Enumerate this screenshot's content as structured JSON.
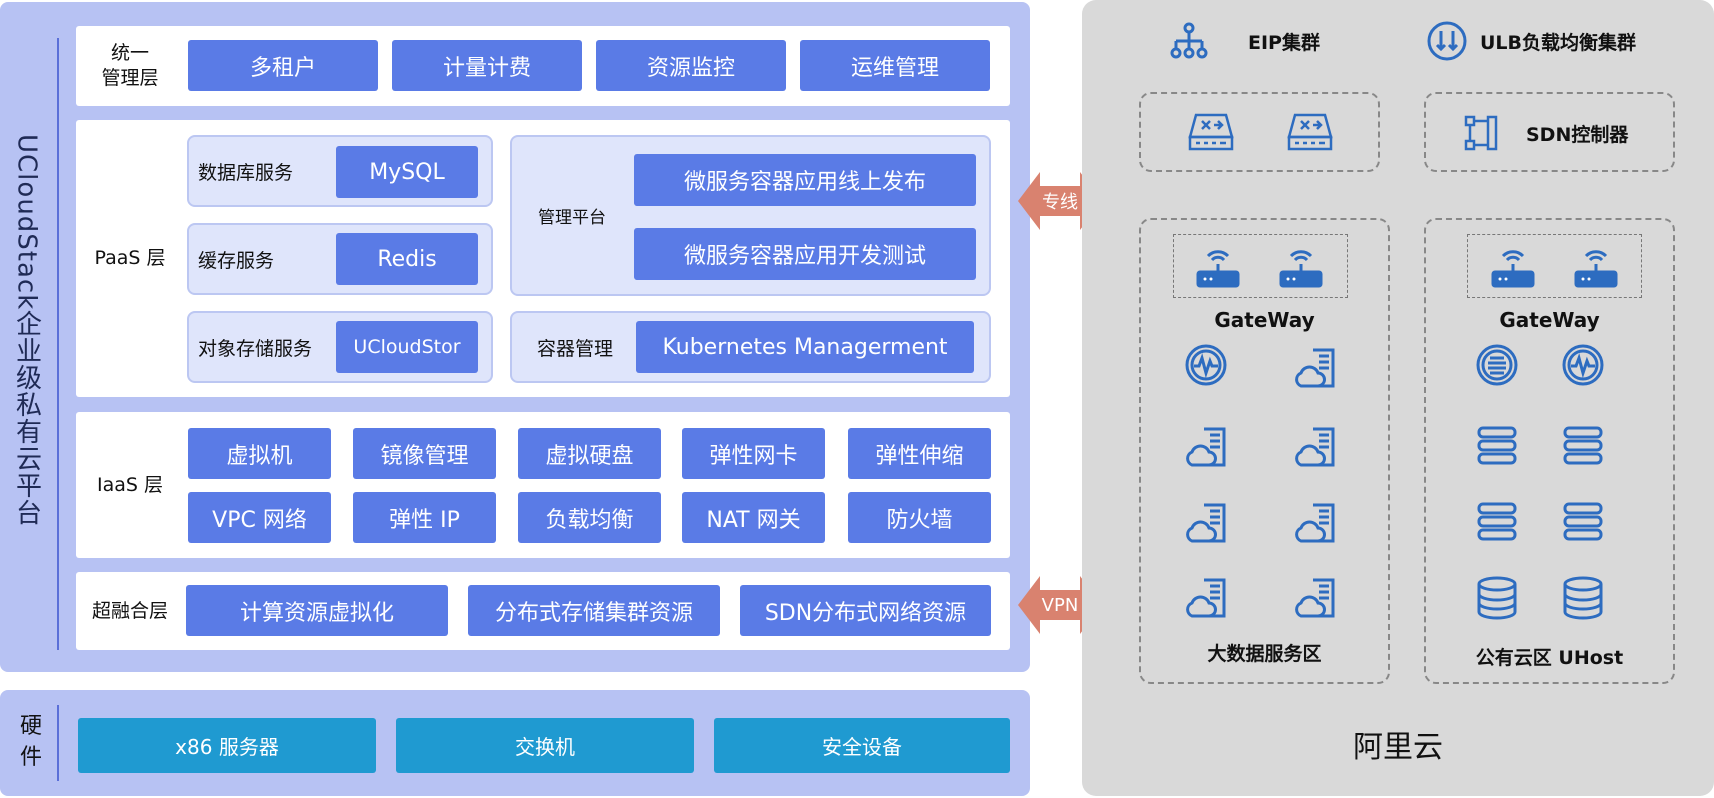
{
  "platform_title": "UCloudStack企业级私有云平台",
  "mgmt_layer": {
    "label": "统一\n管理层",
    "items": [
      "多租户",
      "计量计费",
      "资源监控",
      "运维管理"
    ]
  },
  "paas_layer": {
    "label": "PaaS 层",
    "db": {
      "label": "数据库服务",
      "value": "MySQL"
    },
    "cache": {
      "label": "缓存服务",
      "value": "Redis"
    },
    "storage": {
      "label": "对象存储服务",
      "value": "UCloudStor"
    },
    "mgmt_platform": {
      "label": "管理平台",
      "items": [
        "微服务容器应用线上发布",
        "微服务容器应用开发测试"
      ]
    },
    "container": {
      "label": "容器管理",
      "value": "Kubernetes Managerment"
    }
  },
  "iaas_layer": {
    "label": "IaaS 层",
    "row1": [
      "虚拟机",
      "镜像管理",
      "虚拟硬盘",
      "弹性网卡",
      "弹性伸缩"
    ],
    "row2": [
      "VPC 网络",
      "弹性 IP",
      "负载均衡",
      "NAT 网关",
      "防火墙"
    ]
  },
  "hci_layer": {
    "label": "超融合层",
    "items": [
      "计算资源虚拟化",
      "分布式存储集群资源",
      "SDN分布式网络资源"
    ]
  },
  "hardware": {
    "label": "硬\n件",
    "items": [
      "x86 服务器",
      "交换机",
      "安全设备"
    ]
  },
  "links": {
    "dedicated": "专线",
    "vpn": "VPN"
  },
  "aliyun": {
    "title": "阿里云",
    "eip": "EIP集群",
    "ulb": "ULB负载均衡集群",
    "sdn": "SDN控制器",
    "gateway": "GateWay",
    "bigdata": "大数据服务区",
    "public": "公有云区 UHost"
  },
  "colors": {
    "panel": "#b7c2f3",
    "button": "#5a7be6",
    "hardware_button": "#1f9ad1",
    "arrow": "#d9826f",
    "icon": "#2d6cc0",
    "aliyun_bg": "#d9d9d9"
  }
}
